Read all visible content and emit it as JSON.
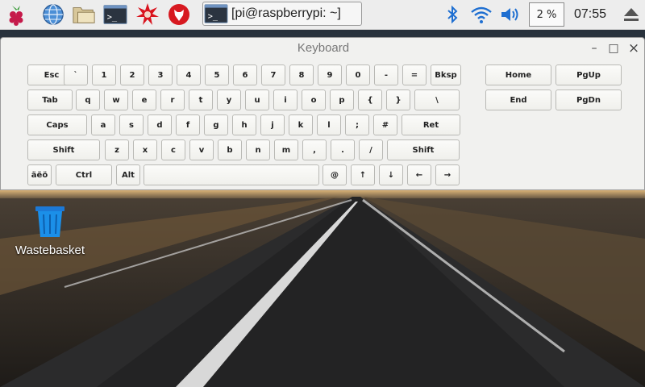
{
  "taskbar": {
    "launchers": [
      {
        "name": "raspberry-menu-icon"
      },
      {
        "name": "web-browser-icon"
      },
      {
        "name": "file-manager-icon"
      },
      {
        "name": "terminal-icon"
      },
      {
        "name": "mathematica-icon"
      },
      {
        "name": "wolfram-icon"
      }
    ],
    "task_label": "[pi@raspberrypi: ~]",
    "cpu_label": "2 %",
    "clock": "07:55",
    "tray": [
      "bluetooth-icon",
      "wifi-icon",
      "volume-icon",
      "eject-icon"
    ]
  },
  "desktop": {
    "icons": [
      {
        "label": "Wastebasket",
        "icon": "trash-icon"
      }
    ]
  },
  "keyboard": {
    "title": "Keyboard",
    "controls": {
      "minimize": "–",
      "maximize": "□",
      "close": "×"
    },
    "rows": [
      [
        "Esc",
        "`",
        "1",
        "2",
        "3",
        "4",
        "5",
        "6",
        "7",
        "8",
        "9",
        "0",
        "-",
        "=",
        "Bksp"
      ],
      [
        "Tab",
        "q",
        "w",
        "e",
        "r",
        "t",
        "y",
        "u",
        "i",
        "o",
        "p",
        "{",
        "}",
        "\\"
      ],
      [
        "Caps",
        "a",
        "s",
        "d",
        "f",
        "g",
        "h",
        "j",
        "k",
        "l",
        ";",
        "#",
        "Ret"
      ],
      [
        "Shift",
        "z",
        "x",
        "c",
        "v",
        "b",
        "n",
        "m",
        ",",
        ".",
        "/",
        "Shift"
      ],
      [
        "äëö",
        "Ctrl",
        "Alt",
        "",
        "@",
        "↑",
        "↓",
        "←",
        "→"
      ]
    ],
    "nav": [
      [
        "Home",
        "PgUp"
      ],
      [
        "End",
        "PgDn"
      ]
    ]
  }
}
